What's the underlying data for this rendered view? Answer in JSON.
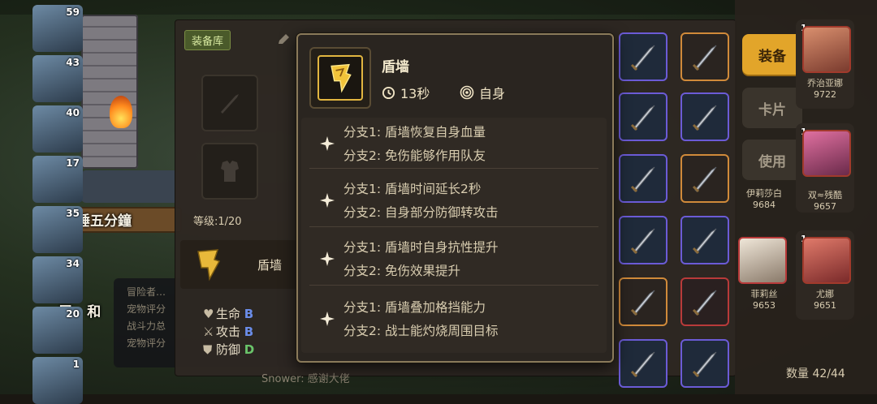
{
  "background": {
    "avatar_levels": [
      "59",
      "43",
      "40",
      "17",
      "35",
      "34",
      "20",
      "1"
    ],
    "scene_label": "睡五分鐘",
    "bubble_lines": [
      "冒险者…",
      "宠物评分",
      "战斗力总",
      "宠物评分"
    ],
    "side_label_fragment": "层 · 和",
    "ticker": "Snower: 感谢大佬"
  },
  "equip_panel": {
    "tag": "装备库",
    "level": "等级:1/20",
    "skill_name": "盾墙",
    "stats": [
      {
        "icon": "heart-icon",
        "label": "生命",
        "grade": "B",
        "grade_class": "grade-b"
      },
      {
        "icon": "sword-icon",
        "label": "攻击",
        "grade": "B",
        "grade_class": "grade-b"
      },
      {
        "icon": "shield-icon",
        "label": "防御",
        "grade": "D",
        "grade_class": "grade-d"
      }
    ]
  },
  "side_menu": {
    "equip": "装备",
    "card": "卡片",
    "use": "使用"
  },
  "heroes": [
    {
      "level": "1",
      "name": "乔治亚娜",
      "power": "9722"
    },
    {
      "level": "1",
      "name": "伊莉莎白",
      "power": "9684"
    },
    {
      "level": "1",
      "name": "双≈残酷",
      "power": "9657"
    },
    {
      "level": "1",
      "name": "菲莉丝",
      "power": "9653"
    },
    {
      "level": "1",
      "name": "尤娜",
      "power": "9651"
    }
  ],
  "inventory_count": "数量 42/44",
  "tooltip": {
    "title": "盾墙",
    "cooldown_icon": "clock-icon",
    "cooldown": "13秒",
    "target_icon": "target-icon",
    "target": "自身",
    "branches": [
      {
        "line1": "分支1:  盾墙恢复自身血量",
        "line2": "分支2:  免伤能够作用队友"
      },
      {
        "line1": "分支1:  盾墙时间延长2秒",
        "line2": "分支2:  自身部分防御转攻击"
      },
      {
        "line1": "分支1:  盾墙时自身抗性提升",
        "line2": "分支2:  免伤效果提升"
      },
      {
        "line1": "分支1:  盾墙叠加格挡能力",
        "line2": "分支2:  战士能灼烧周围目标"
      }
    ]
  },
  "colors": {
    "accent_gold": "#e2a52a",
    "grade_b": "#6a8ce8",
    "grade_d": "#6ac46a",
    "item_border_purple": "#6b5bd6"
  }
}
